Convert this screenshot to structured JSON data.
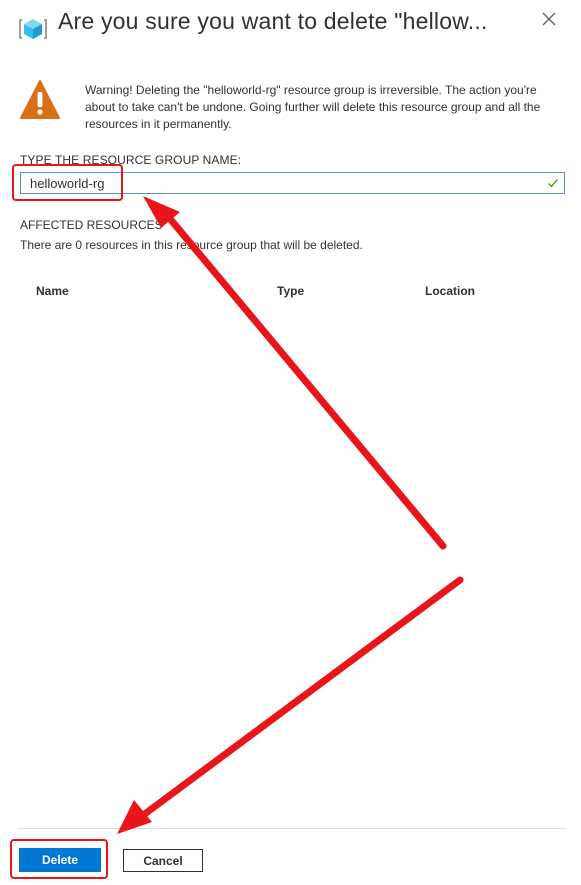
{
  "dialog": {
    "title": "Are you sure you want to delete \"hellow...",
    "resource_group_icon": "resource-group-cube-icon",
    "close_icon": "close-icon"
  },
  "warning": {
    "icon": "warning-triangle-icon",
    "text": "Warning! Deleting the \"helloworld-rg\" resource group is irreversible. The action you're about to take can't be undone. Going further will delete this resource group and all the resources in it permanently."
  },
  "confirm_field": {
    "label": "TYPE THE RESOURCE GROUP NAME:",
    "value": "helloworld-rg",
    "valid_icon": "checkmark-icon"
  },
  "affected": {
    "title": "AFFECTED RESOURCES",
    "description": "There are 0 resources in this resource group that will be deleted.",
    "columns": [
      "Name",
      "Type",
      "Location"
    ]
  },
  "footer": {
    "delete_label": "Delete",
    "cancel_label": "Cancel"
  },
  "colors": {
    "primary": "#0078d4",
    "warning": "#d87015",
    "annotation": "#e8151a",
    "valid": "#57a300"
  }
}
